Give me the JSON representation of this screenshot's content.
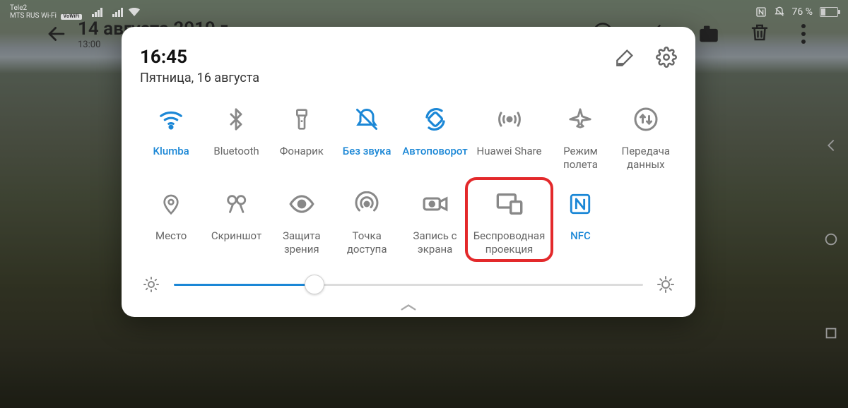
{
  "statusbar": {
    "carrier1": "Tele2",
    "carrier2": "MTS RUS Wi-Fi",
    "vowifi": "VoWiFi",
    "battery_pct": "76 %"
  },
  "appbar": {
    "title": "14 августа 2019 г.",
    "time": "13:00"
  },
  "panel": {
    "time": "16:45",
    "date": "Пятница, 16 августа",
    "brightness_pct": 30
  },
  "tiles": {
    "row1": [
      {
        "name": "wifi",
        "label": "Klumba",
        "active": true
      },
      {
        "name": "bluetooth",
        "label": "Bluetooth",
        "active": false
      },
      {
        "name": "flashlight",
        "label": "Фонарик",
        "active": false
      },
      {
        "name": "silent",
        "label": "Без звука",
        "active": true
      },
      {
        "name": "autorotate",
        "label": "Автоповорот",
        "active": true
      },
      {
        "name": "huaweishare",
        "label": "Huawei Share",
        "active": false
      },
      {
        "name": "airplane",
        "label": "Режим полета",
        "active": false
      },
      {
        "name": "datatransfer",
        "label": "Передача данных",
        "active": false
      }
    ],
    "row2": [
      {
        "name": "location",
        "label": "Место",
        "active": false
      },
      {
        "name": "screenshot",
        "label": "Скриншот",
        "active": false
      },
      {
        "name": "eyecomfort",
        "label": "Защита зрения",
        "active": false
      },
      {
        "name": "hotspot",
        "label": "Точка доступа",
        "active": false
      },
      {
        "name": "screenrecord",
        "label": "Запись с экрана",
        "active": false
      },
      {
        "name": "cast",
        "label": "Беспроводная проекция",
        "active": false,
        "highlight": true
      },
      {
        "name": "nfc",
        "label": "NFC",
        "active": true
      }
    ]
  }
}
